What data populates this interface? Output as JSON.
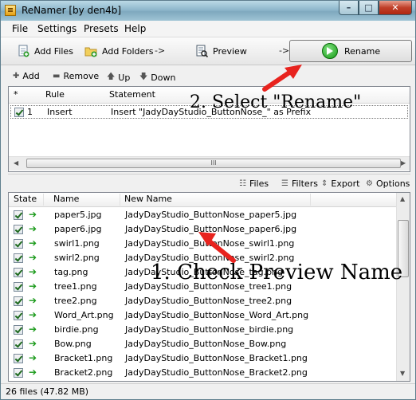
{
  "window": {
    "title": "ReNamer  [by den4b]"
  },
  "menu": [
    "File",
    "Settings",
    "Presets",
    "Help"
  ],
  "toolbar": {
    "add_files": "Add Files",
    "add_folders": "Add Folders",
    "arrow1": "->",
    "preview": "Preview",
    "arrow2": "->",
    "rename": "Rename"
  },
  "rule_toolbar": {
    "add": "Add",
    "remove": "Remove",
    "up": "Up",
    "down": "Down"
  },
  "rules_table": {
    "columns": [
      "*",
      "Rule",
      "Statement"
    ],
    "rows": [
      {
        "index": "1",
        "rule": "Insert",
        "statement": "Insert \"JadyDayStudio_ButtonNose_\" as Prefix"
      }
    ]
  },
  "file_toolbar": {
    "files": "Files",
    "filters": "Filters",
    "export": "Export",
    "options": "Options"
  },
  "files_table": {
    "columns": [
      "State",
      "Name",
      "New Name"
    ],
    "rows": [
      {
        "name": "paper5.jpg",
        "new_name": "JadyDayStudio_ButtonNose_paper5.jpg"
      },
      {
        "name": "paper6.jpg",
        "new_name": "JadyDayStudio_ButtonNose_paper6.jpg"
      },
      {
        "name": "swirl1.png",
        "new_name": "JadyDayStudio_ButtonNose_swirl1.png"
      },
      {
        "name": "swirl2.png",
        "new_name": "JadyDayStudio_ButtonNose_swirl2.png"
      },
      {
        "name": "tag.png",
        "new_name": "JadyDayStudio_ButtonNose_tag.png"
      },
      {
        "name": "tree1.png",
        "new_name": "JadyDayStudio_ButtonNose_tree1.png"
      },
      {
        "name": "tree2.png",
        "new_name": "JadyDayStudio_ButtonNose_tree2.png"
      },
      {
        "name": "Word_Art.png",
        "new_name": "JadyDayStudio_ButtonNose_Word_Art.png"
      },
      {
        "name": "birdie.png",
        "new_name": "JadyDayStudio_ButtonNose_birdie.png"
      },
      {
        "name": "Bow.png",
        "new_name": "JadyDayStudio_ButtonNose_Bow.png"
      },
      {
        "name": "Bracket1.png",
        "new_name": "JadyDayStudio_ButtonNose_Bracket1.png"
      },
      {
        "name": "Bracket2.png",
        "new_name": "JadyDayStudio_ButtonNose_Bracket2.png"
      }
    ]
  },
  "status": "26 files (47.82 MB)",
  "annotations": {
    "step1": "1. Check Preview Name",
    "step2": "2. Select \"Rename\""
  },
  "colors": {
    "annotation_arrow": "#e8231e",
    "ok_arrow": "#1a9a1a",
    "go_button": "#149a14"
  },
  "icons": {
    "app": "renamer-app-icon",
    "add_files": "add-files-icon",
    "add_folders": "add-folders-icon",
    "preview": "preview-icon",
    "rename": "rename-go-icon",
    "rule_add": "plus-icon",
    "rule_remove": "minus-icon",
    "rule_up": "arrow-up-icon",
    "rule_down": "arrow-down-icon",
    "files": "files-icon",
    "filters": "filters-icon",
    "export": "export-icon",
    "options": "options-icon",
    "state_ok": "green-arrow-icon"
  }
}
